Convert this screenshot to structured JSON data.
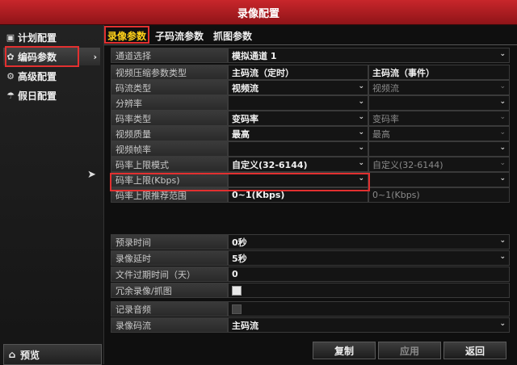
{
  "window": {
    "title": "录像配置"
  },
  "sidebar": {
    "items": [
      {
        "label": "计划配置",
        "icon": "calendar-icon"
      },
      {
        "label": "编码参数",
        "icon": "gear-icon"
      },
      {
        "label": "高级配置",
        "icon": "settings-icon"
      },
      {
        "label": "假日配置",
        "icon": "holiday-icon"
      }
    ],
    "preview_label": "预览",
    "preview_icon": "home-icon"
  },
  "tabs": [
    "录像参数",
    "子码流参数",
    "抓图参数"
  ],
  "form": {
    "channel": {
      "label": "通道选择",
      "value": "模拟通道 1"
    },
    "header": {
      "label": "视频压缩参数类型",
      "main": "主码流（定时）",
      "event": "主码流（事件）"
    },
    "rows": [
      {
        "label": "码流类型",
        "main": "视频流",
        "event": "视频流",
        "event_dim": true
      },
      {
        "label": "分辨率",
        "main": "",
        "event": ""
      },
      {
        "label": "码率类型",
        "main": "变码率",
        "event": "变码率",
        "event_dim": true
      },
      {
        "label": "视频质量",
        "main": "最高",
        "event": "最高",
        "event_dim": true
      },
      {
        "label": "视频帧率",
        "main": "",
        "event": ""
      },
      {
        "label": "码率上限模式",
        "main": "自定义(32-6144)",
        "event": "自定义(32-6144)",
        "event_dim": true
      },
      {
        "label": "码率上限(Kbps)",
        "main": "",
        "event": ""
      },
      {
        "label": "码率上限推荐范围",
        "main": "0~1(Kbps)",
        "event": "0~1(Kbps)",
        "event_dim": true
      }
    ],
    "pre_record": {
      "label": "预录时间",
      "value": "0秒"
    },
    "post_record": {
      "label": "录像延时",
      "value": "5秒"
    },
    "expire": {
      "label": "文件过期时间（天）",
      "value": "0"
    },
    "redundant": {
      "label": "冗余录像/抓图",
      "checked": true
    },
    "audio": {
      "label": "记录音频",
      "checked": false,
      "disabled": true
    },
    "stream": {
      "label": "录像码流",
      "value": "主码流"
    }
  },
  "buttons": {
    "copy": "复制",
    "apply": "应用",
    "back": "返回"
  },
  "colors": {
    "title_bar": "#b81f24",
    "highlight": "#e23030",
    "active_tab": "#ffd11a"
  }
}
